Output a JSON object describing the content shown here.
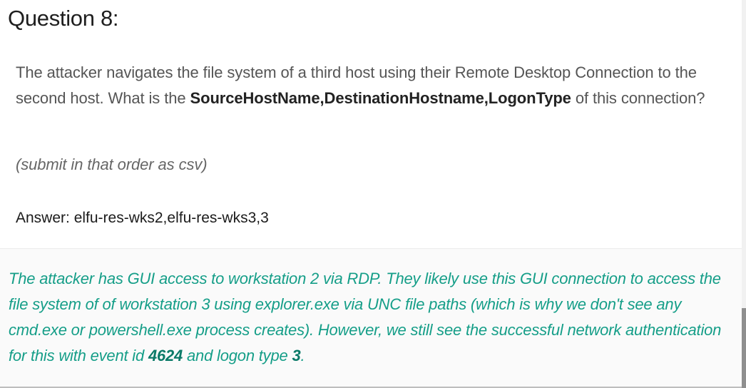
{
  "question": {
    "title": "Question 8:",
    "text_part1": "The attacker navigates the file system of a third host using their Remote Desktop Connection to the second host. What is the ",
    "text_bold": "SourceHostName,DestinationHostname,LogonType",
    "text_part2": " of this connection?",
    "note": "(submit in that order as csv)",
    "answer": "Answer: elfu-res-wks2,elfu-res-wks3,3"
  },
  "explanation": {
    "part1": "The attacker has GUI access to workstation 2 via RDP. They likely use this GUI connection to access the file system of of workstation 3 using explorer.exe via UNC file paths (which is why we don't see any cmd.exe or powershell.exe process creates). However, we still see the successful network authentication for this with event id ",
    "event_id": "4624",
    "part2": " and logon type ",
    "logon_type": "3",
    "part3": "."
  },
  "colors": {
    "explanation_text": "#159e88",
    "explanation_bold": "#0b7a68",
    "question_text": "#555555"
  }
}
